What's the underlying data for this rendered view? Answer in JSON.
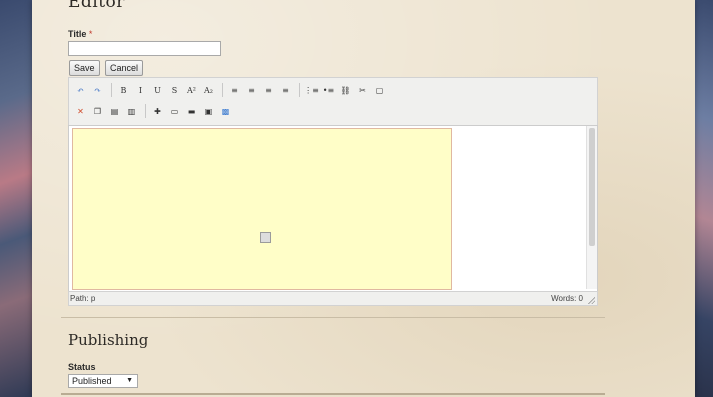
{
  "editor": {
    "heading": "Editor",
    "title_label": "Title",
    "required_mark": "*",
    "title_value": "",
    "save_label": "Save",
    "cancel_label": "Cancel"
  },
  "toolbar": {
    "row1": [
      {
        "name": "undo-icon",
        "glyph": "↶",
        "color": "#3a6fc4"
      },
      {
        "name": "redo-icon",
        "glyph": "↷",
        "color": "#3a6fc4"
      },
      {
        "name": "bold-button",
        "glyph": "B"
      },
      {
        "name": "italic-button",
        "glyph": "I"
      },
      {
        "name": "underline-button",
        "glyph": "U"
      },
      {
        "name": "strikethrough-button",
        "glyph": "S"
      },
      {
        "name": "superscript-button",
        "glyph": "A²"
      },
      {
        "name": "subscript-button",
        "glyph": "A₂"
      },
      {
        "name": "align-left-icon",
        "glyph": "≡"
      },
      {
        "name": "align-center-icon",
        "glyph": "≡"
      },
      {
        "name": "align-right-icon",
        "glyph": "≡"
      },
      {
        "name": "justify-icon",
        "glyph": "≡"
      },
      {
        "name": "numbered-list-icon",
        "glyph": "⋮≡"
      },
      {
        "name": "bullet-list-icon",
        "glyph": "•≡"
      },
      {
        "name": "link-icon",
        "glyph": "⛓"
      },
      {
        "name": "unlink-icon",
        "glyph": "✂"
      },
      {
        "name": "fullscreen-icon",
        "glyph": "▢"
      }
    ],
    "row2": [
      {
        "name": "cut-icon",
        "glyph": "✕",
        "color": "#d04a2a"
      },
      {
        "name": "copy-icon",
        "glyph": "❐"
      },
      {
        "name": "paste-icon",
        "glyph": "▤"
      },
      {
        "name": "paste-text-icon",
        "glyph": "▥"
      },
      {
        "name": "insert-table-icon",
        "glyph": "✚"
      },
      {
        "name": "insert-row-icon",
        "glyph": "▭"
      },
      {
        "name": "horizontal-rule-icon",
        "glyph": "▬"
      },
      {
        "name": "insert-media-icon",
        "glyph": "▣"
      },
      {
        "name": "insert-image-icon",
        "glyph": "▩",
        "color": "#3a7ad0"
      }
    ]
  },
  "statusbar": {
    "path": "Path: p",
    "words": "Words: 0"
  },
  "publishing": {
    "heading": "Publishing",
    "status_label": "Status",
    "status_value": "Published"
  }
}
